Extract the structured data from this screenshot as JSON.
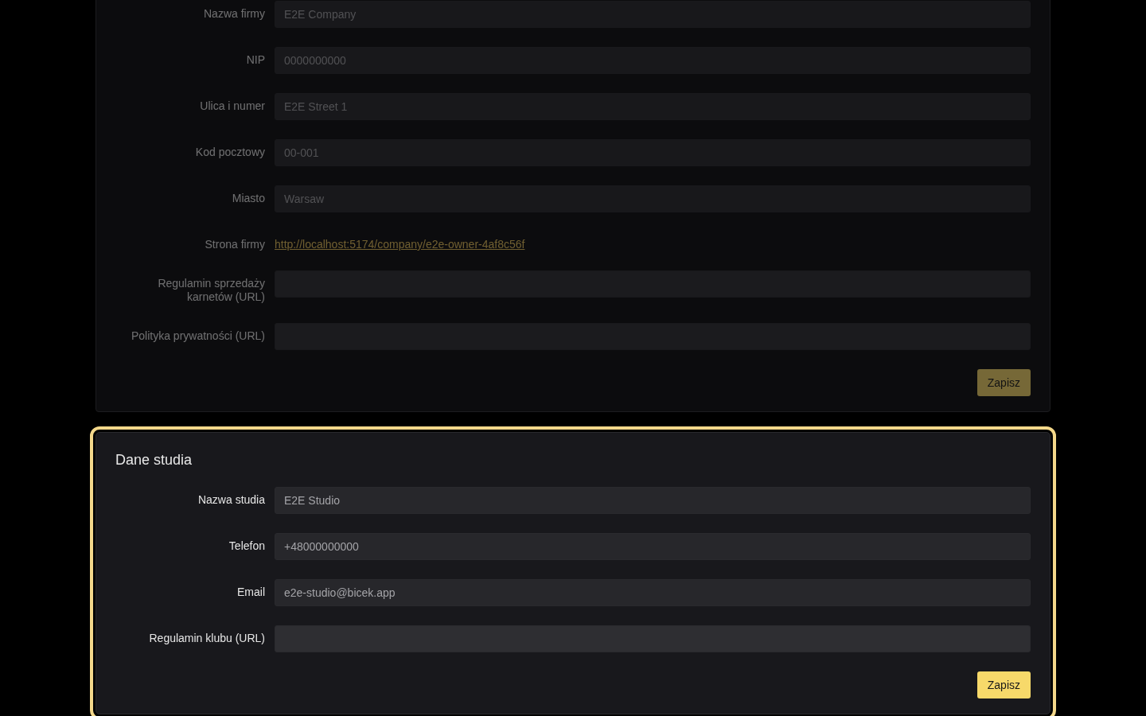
{
  "sections": [
    {
      "highlighted": false,
      "fields": [
        {
          "kind": "input",
          "label": "Nazwa firmy",
          "value": "E2E Company"
        },
        {
          "kind": "input",
          "label": "NIP",
          "value": "0000000000"
        },
        {
          "kind": "input",
          "label": "Ulica i numer",
          "value": "E2E Street 1"
        },
        {
          "kind": "input",
          "label": "Kod pocztowy",
          "value": "00-001"
        },
        {
          "kind": "input",
          "label": "Miasto",
          "value": "Warsaw"
        },
        {
          "kind": "link",
          "label": "Strona firmy",
          "value": "http://localhost:5174/company/e2e-owner-4af8c56f"
        },
        {
          "kind": "input",
          "label": "Regulamin sprzedaży karnetów (URL)"
        },
        {
          "kind": "input",
          "label": "Polityka prywatności (URL)"
        }
      ],
      "button": "Zapisz"
    },
    {
      "highlighted": true,
      "title": "Dane studia",
      "fields": [
        {
          "kind": "input",
          "label": "Nazwa studia",
          "value": "E2E Studio"
        },
        {
          "kind": "input",
          "label": "Telefon",
          "value": "+48000000000"
        },
        {
          "kind": "input",
          "label": "Email",
          "value": "e2e-studio@bicek.app"
        },
        {
          "kind": "input",
          "label": "Regulamin klubu (URL)"
        }
      ],
      "button": "Zapisz"
    }
  ]
}
